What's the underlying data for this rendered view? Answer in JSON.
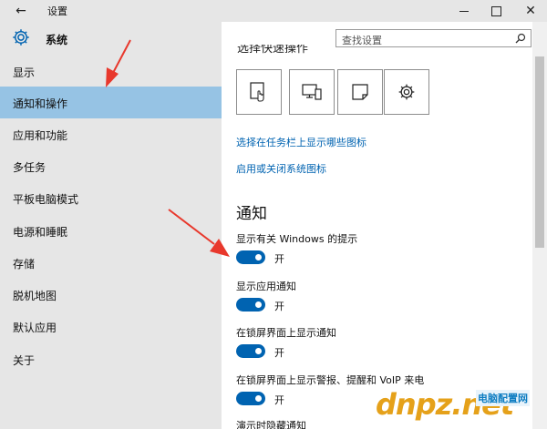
{
  "window": {
    "title": "设置",
    "back_icon": "back-arrow-icon",
    "controls": [
      "minimize-icon",
      "maximize-icon",
      "close-icon"
    ]
  },
  "sidebar": {
    "header_title": "系统",
    "header_icon": "gear-icon",
    "items": [
      {
        "label": "显示"
      },
      {
        "label": "通知和操作",
        "active": true
      },
      {
        "label": "应用和功能"
      },
      {
        "label": "多任务"
      },
      {
        "label": "平板电脑模式"
      },
      {
        "label": "电源和睡眠"
      },
      {
        "label": "存储"
      },
      {
        "label": "脱机地图"
      },
      {
        "label": "默认应用"
      },
      {
        "label": "关于"
      }
    ]
  },
  "search": {
    "placeholder": "查找设置",
    "icon": "search-icon"
  },
  "quick_actions": {
    "heading_partial": "选择快速操作",
    "tiles": [
      {
        "icon": "tablet-mode-icon"
      },
      {
        "icon": "connect-display-icon"
      },
      {
        "icon": "note-icon"
      },
      {
        "icon": "settings-gear-icon"
      }
    ]
  },
  "links": {
    "taskbar_icons": "选择在任务栏上显示哪些图标",
    "system_icons": "启用或关闭系统图标"
  },
  "notifications": {
    "title": "通知",
    "options": [
      {
        "label": "显示有关 Windows 的提示",
        "state": "开",
        "on": true
      },
      {
        "label": "显示应用通知",
        "state": "开",
        "on": true
      },
      {
        "label": "在锁屏界面上显示通知",
        "state": "开",
        "on": true
      },
      {
        "label": "在锁屏界面上显示警报、提醒和 VoIP 来电",
        "state": "开",
        "on": true
      }
    ],
    "cut_off_label": "演示时隐藏通知"
  },
  "watermark": {
    "brand": "dnpz.net",
    "tagline": "电脑配置网"
  },
  "colors": {
    "accent": "#0063b1",
    "sidebar_bg": "#e6e6e6",
    "selected_bg": "#96c3e4",
    "arrow": "#e8382c"
  }
}
